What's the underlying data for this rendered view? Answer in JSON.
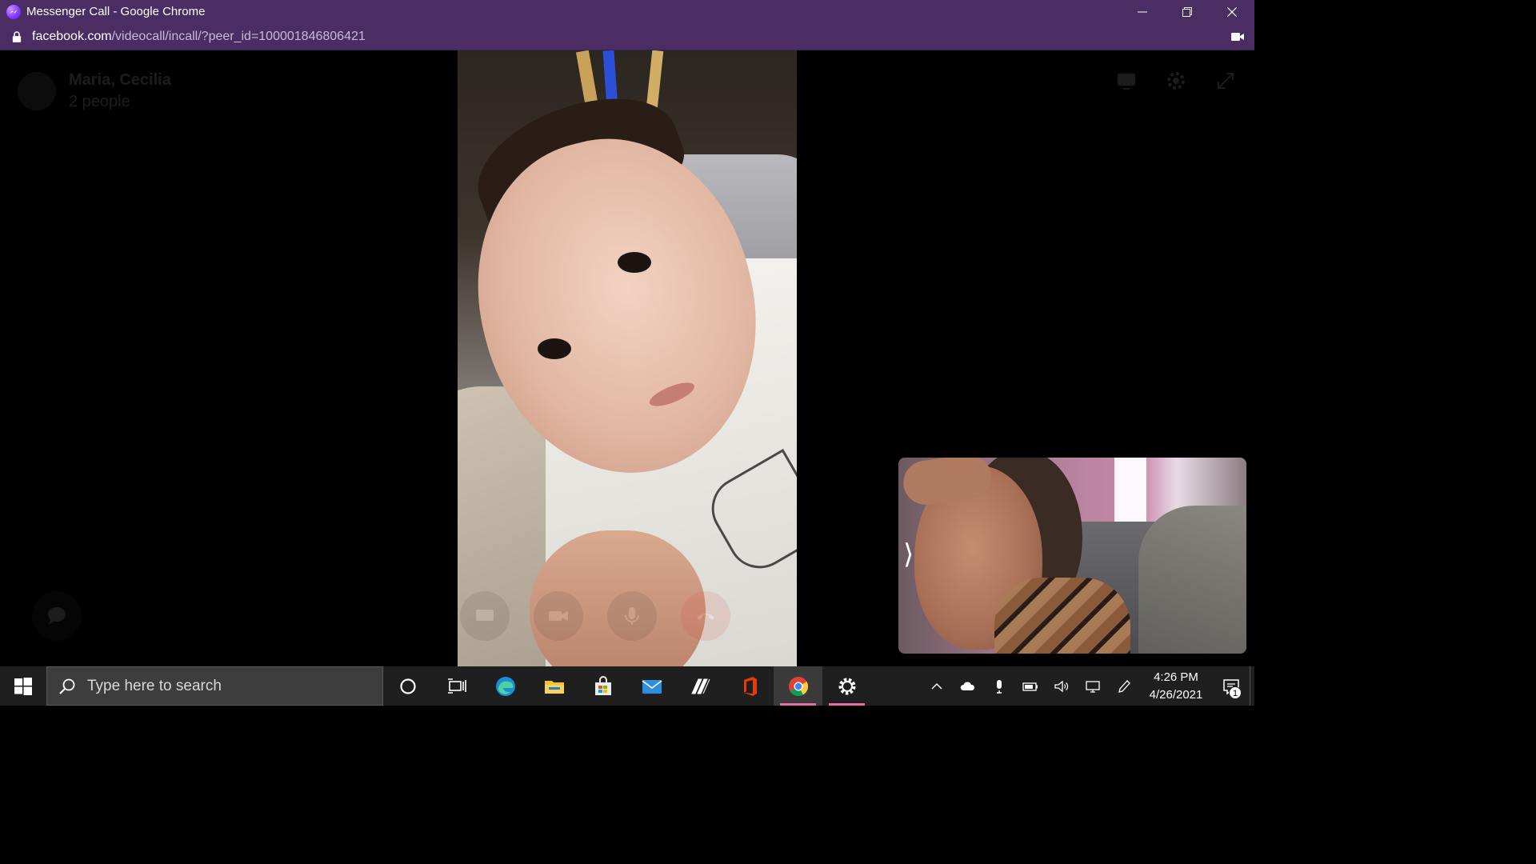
{
  "window": {
    "title": "Messenger Call - Google Chrome"
  },
  "address_bar": {
    "host": "facebook.com",
    "path": "/videocall/incall/?peer_id=100001846806421"
  },
  "call": {
    "title": "Maria, Cecilia",
    "subtitle": "2 people",
    "self_view_toggle": "⟩"
  },
  "taskbar": {
    "search_placeholder": "Type here to search",
    "pinned": [
      "cortana-icon",
      "task-view-icon",
      "edge-icon",
      "file-explorer-icon",
      "microsoft-store-icon",
      "mail-icon",
      "app-icon",
      "office-icon",
      "chrome-icon",
      "settings-icon"
    ],
    "clock_time": "4:26 PM",
    "clock_date": "4/26/2021",
    "notification_count": "1"
  },
  "colors": {
    "chrome_frame": "#4b2c63",
    "taskbar": "#1f1f1f",
    "active_underline": "#e86aa6",
    "end_call": "#e22d2d"
  }
}
